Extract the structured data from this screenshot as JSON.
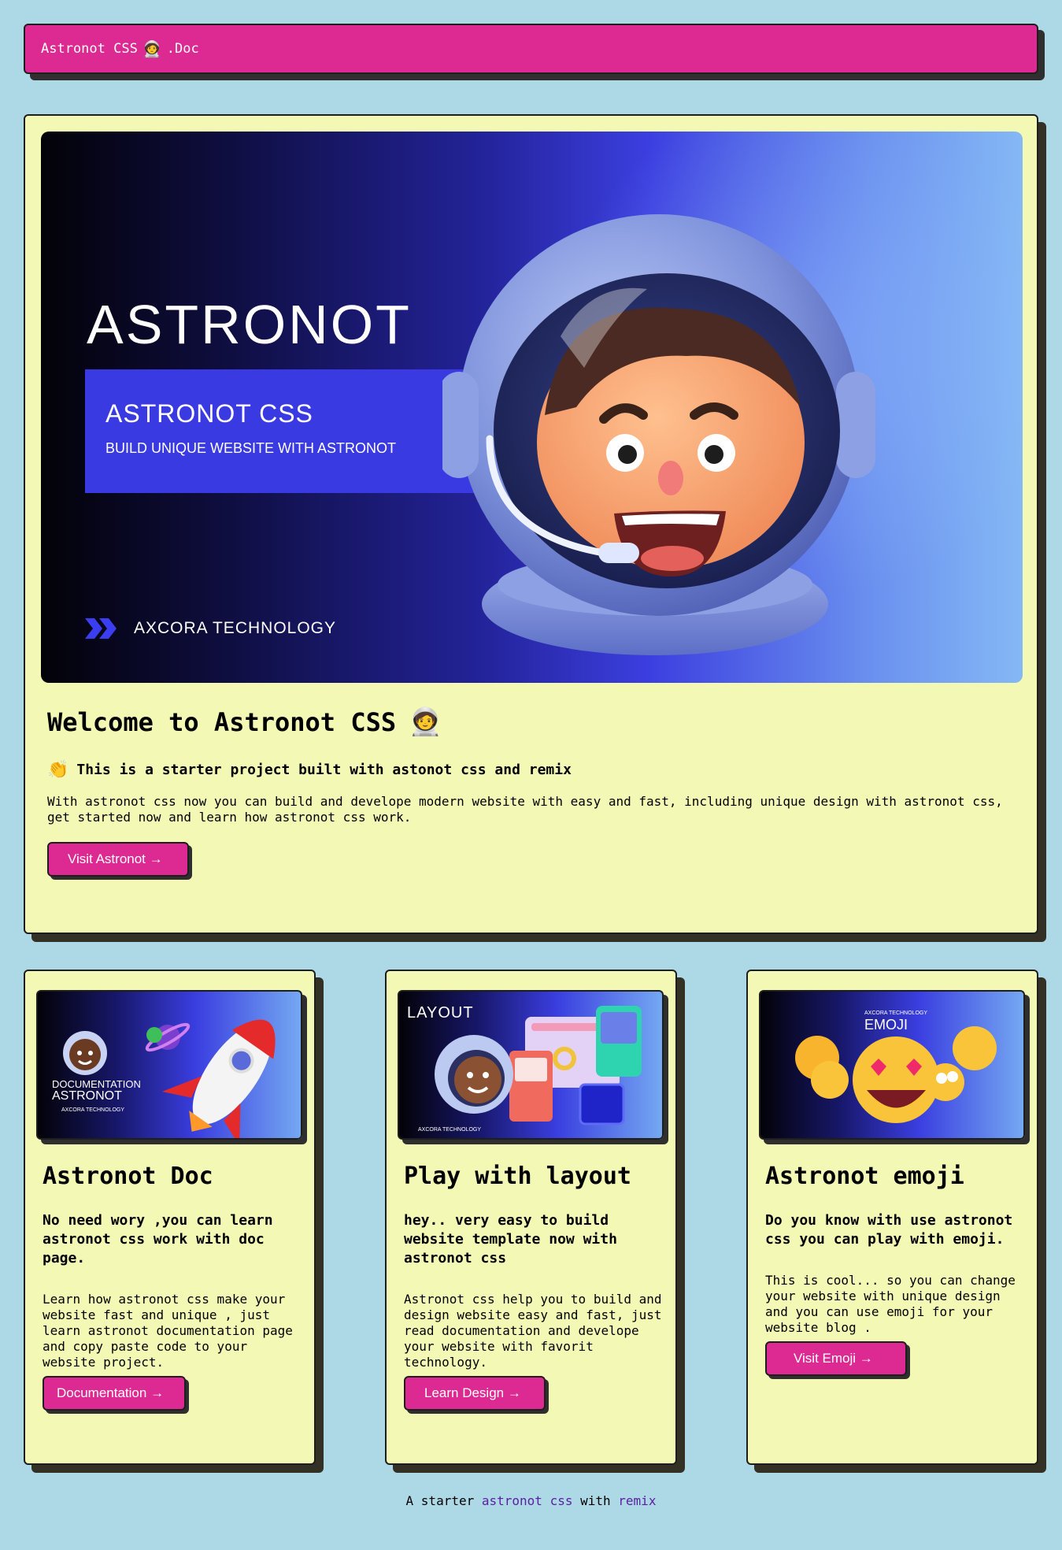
{
  "nav": {
    "brand": "Astronot CSS",
    "brand_emoji": "🧑‍🚀",
    "suffix": ".Doc"
  },
  "hero": {
    "banner": {
      "big_title": "ASTRONOT",
      "box_title": "ASTRONOT CSS",
      "box_subtitle": "BUILD UNIQUE WEBSITE WITH ASTRONOT",
      "brand": "AXCORA TECHNOLOGY"
    },
    "title": "Welcome to Astronot CSS",
    "title_emoji": "🧑‍🚀",
    "subtitle_emoji": "👏",
    "subtitle": "This is a starter project built with astonot css and remix",
    "description": "With astronot css now you can build and develope modern website with easy and fast, including unique design with astronot css, get started now and learn how astronot css work.",
    "button": "Visit Astronot →"
  },
  "cards": [
    {
      "image_line1": "DOCUMENTATION",
      "image_line2": "ASTRONOT",
      "image_brand": "AXCORA TECHNOLOGY",
      "title": "Astronot Doc",
      "subtitle": "No need wory ,you can learn astronot css work with doc page.",
      "description": "Learn how astronot css make your website fast and unique , just learn astronot documentation page and copy paste code to your website project.",
      "button": "Documentation →"
    },
    {
      "image_line1": "LAYOUT",
      "image_brand": "AXCORA TECHNOLOGY",
      "title": "Play with layout",
      "subtitle": "hey.. very easy to build website template now with astronot css",
      "description": "Astronot css help you to build and design website easy and fast, just read documentation and develope your website with favorit technology.",
      "button": "Learn Design →"
    },
    {
      "image_brand": "AXCORA TECHNOLOGY",
      "image_line1": "EMOJI",
      "title": "Astronot emoji",
      "subtitle": "Do you know with use astronot css you can play with emoji.",
      "description": "This is cool... so you can change your website with unique design and you can use emoji for your website blog .",
      "button": "Visit Emoji →"
    }
  ],
  "footer": {
    "prefix": "A starter",
    "link1": "astronot css",
    "middle": "with",
    "link2": "remix"
  }
}
